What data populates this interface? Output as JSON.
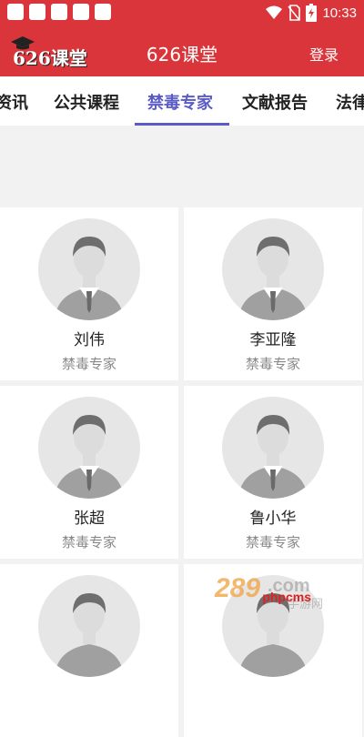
{
  "status_bar": {
    "time": "10:33"
  },
  "header": {
    "logo_text": "626课堂",
    "title": "626课堂",
    "login": "登录"
  },
  "tabs": [
    {
      "label": "资讯",
      "active": false
    },
    {
      "label": "公共课程",
      "active": false
    },
    {
      "label": "禁毒专家",
      "active": true
    },
    {
      "label": "文献报告",
      "active": false
    },
    {
      "label": "法律",
      "active": false
    }
  ],
  "experts": [
    {
      "name": "刘伟",
      "title": "禁毒专家"
    },
    {
      "name": "李亚隆",
      "title": "禁毒专家"
    },
    {
      "name": "张超",
      "title": "禁毒专家"
    },
    {
      "name": "鲁小华",
      "title": "禁毒专家"
    },
    {
      "name": "",
      "title": ""
    },
    {
      "name": "",
      "title": ""
    }
  ],
  "watermark": {
    "number": "289",
    "domain": ".com",
    "cn": "手游网",
    "site": "phpcms"
  },
  "colors": {
    "brand_red": "#d9353a",
    "tab_active": "#5b5bc7"
  }
}
